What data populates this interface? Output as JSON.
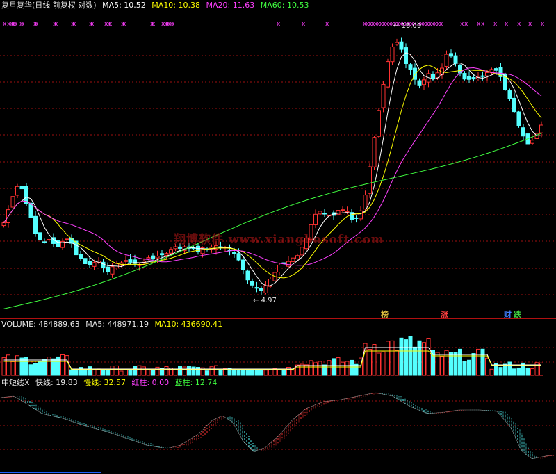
{
  "main_header": {
    "title": "复旦复华(日线 前复权 对数)",
    "ma5": "MA5: 10.52",
    "ma10": "MA10: 10.38",
    "ma20": "MA20: 11.63",
    "ma60": "MA60: 10.53"
  },
  "volume_header": {
    "volume": "VOLUME: 484889.63",
    "ma5": "MA5: 448971.19",
    "ma10": "MA10: 436690.41"
  },
  "oscillator_header": {
    "name": "中短线X",
    "fast": "快线: 19.83",
    "slow": "慢线: 32.57",
    "red_bar": "红柱: 0.00",
    "blue_bar": "蓝柱: 12.74"
  },
  "watermark": "翔博软件 www.xiangbosoft.com",
  "price_labels": {
    "high": "16.09",
    "low": "4.97"
  },
  "event_marks": [
    {
      "text": "榜",
      "color": "#e0c040"
    },
    {
      "text": "涨",
      "color": "#ff4040"
    },
    {
      "text": "财",
      "color": "#4080ff"
    },
    {
      "text": "跌",
      "color": "#40d040"
    }
  ],
  "colors": {
    "up": "#ff3232",
    "down": "#54ffff",
    "ma5": "#ffffff",
    "ma10": "#ffff00",
    "ma20": "#ff40ff",
    "ma60": "#40ff40",
    "grid": "#a01010",
    "x_marker": "#ff40ff"
  },
  "chart_data": {
    "type": "candlestick",
    "price_axis": "log",
    "price_range": [
      4.97,
      16.09
    ],
    "high": 16.09,
    "low": 4.97,
    "last_values": {
      "ma5": 10.52,
      "ma10": 10.38,
      "ma20": 11.63,
      "ma60": 10.53,
      "volume": 484889.63,
      "volume_ma5": 448971.19,
      "volume_ma10": 436690.41,
      "fast": 19.83,
      "slow": 32.57,
      "red_bar": 0.0,
      "blue_bar": 12.74
    }
  }
}
